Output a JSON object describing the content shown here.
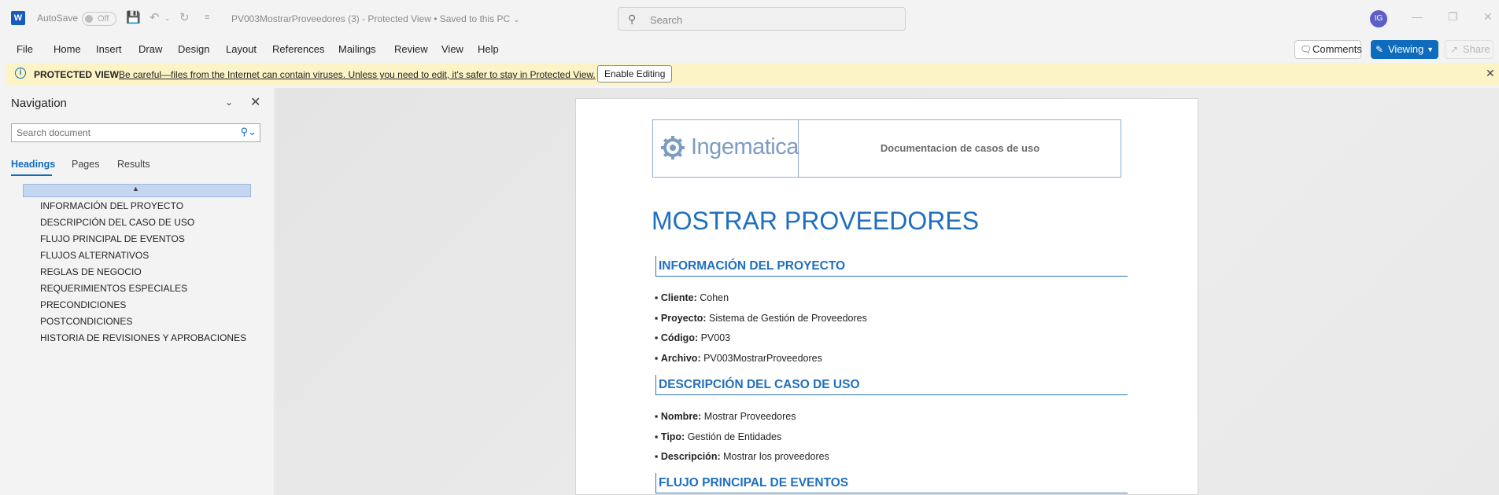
{
  "titlebar": {
    "app_logo": "W",
    "autosave_label": "AutoSave",
    "autosave_state": "Off",
    "doc_title": "PV003MostrarProveedores (3)  -  Protected View  •  Saved to this PC",
    "search_placeholder": "Search",
    "avatar_initials": "IG"
  },
  "menu": {
    "items": [
      "File",
      "Home",
      "Insert",
      "Draw",
      "Design",
      "Layout",
      "References",
      "Mailings",
      "Review",
      "View",
      "Help"
    ],
    "comments_label": "Comments",
    "viewing_label": "Viewing",
    "share_label": "Share"
  },
  "protected_view": {
    "title": "PROTECTED VIEW",
    "message": "Be careful—files from the Internet can contain viruses. Unless you need to edit, it's safer to stay in Protected View.",
    "enable_button": "Enable Editing"
  },
  "navigation": {
    "title": "Navigation",
    "search_placeholder": "Search document",
    "tabs": [
      "Headings",
      "Pages",
      "Results"
    ],
    "active_tab": "Headings",
    "headings": [
      "INFORMACIÓN DEL PROYECTO",
      "DESCRIPCIÓN DEL CASO DE USO",
      "FLUJO PRINCIPAL DE EVENTOS",
      "FLUJOS ALTERNATIVOS",
      "REGLAS DE NEGOCIO",
      "REQUERIMIENTOS ESPECIALES",
      "PRECONDICIONES",
      "POSTCONDICIONES",
      "HISTORIA DE REVISIONES Y APROBACIONES"
    ]
  },
  "document": {
    "header_logo_text": "Ingematica",
    "header_title": "Documentacion de casos de uso",
    "title": "MOSTRAR PROVEEDORES",
    "sections": [
      {
        "heading": "INFORMACIÓN DEL PROYECTO",
        "items": [
          {
            "label": "Cliente:",
            "value": " Cohen"
          },
          {
            "label": "Proyecto:",
            "value": " Sistema de Gestión de Proveedores"
          },
          {
            "label": "Código:",
            "value": " PV003"
          },
          {
            "label": "Archivo:",
            "value": " PV003MostrarProveedores"
          }
        ]
      },
      {
        "heading": "DESCRIPCIÓN DEL CASO DE USO",
        "items": [
          {
            "label": "Nombre:",
            "value": " Mostrar Proveedores"
          },
          {
            "label": "Tipo:",
            "value": " Gestión de Entidades"
          },
          {
            "label": "Descripción:",
            "value": " Mostrar los proveedores"
          }
        ]
      },
      {
        "heading": "FLUJO PRINCIPAL DE EVENTOS",
        "items": []
      }
    ]
  },
  "colors": {
    "accent": "#0f6cbd",
    "protected_bar": "#fcf4c6",
    "heading_blue": "#1f6fbf"
  }
}
